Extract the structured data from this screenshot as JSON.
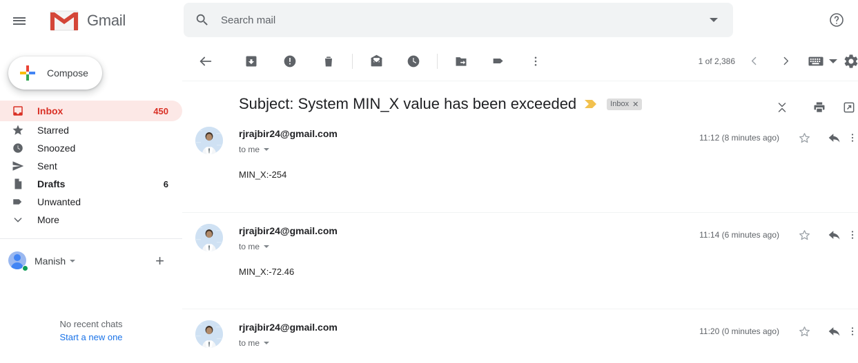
{
  "app": {
    "brand": "Gmail",
    "menu_icon": "hamburger-menu-icon",
    "logo_icon": "gmail-m-logo"
  },
  "search": {
    "placeholder": "Search mail",
    "value": "",
    "icon": "search-icon",
    "options_icon": "chevron-down-icon"
  },
  "header": {
    "help_icon": "help-question-icon"
  },
  "sidebar": {
    "compose": {
      "label": "Compose",
      "icon": "plus-icon"
    },
    "items": [
      {
        "label": "Inbox",
        "count": "450",
        "icon": "inbox-icon",
        "active": true
      },
      {
        "label": "Starred",
        "count": "",
        "icon": "star-icon",
        "active": false
      },
      {
        "label": "Snoozed",
        "count": "",
        "icon": "clock-icon",
        "active": false
      },
      {
        "label": "Sent",
        "count": "",
        "icon": "send-icon",
        "active": false
      },
      {
        "label": "Drafts",
        "count": "6",
        "icon": "draft-file-icon",
        "active": false
      },
      {
        "label": "Unwanted",
        "count": "",
        "icon": "label-tag-icon",
        "active": false
      },
      {
        "label": "More",
        "count": "",
        "icon": "chevron-down-icon",
        "active": false
      }
    ],
    "hangouts": {
      "user": "Manish",
      "user_caret_icon": "caret-down-icon",
      "avatar_icon": "user-avatar-icon",
      "status": "online",
      "new_chat_icon": "plus-icon",
      "empty_text": "No recent chats",
      "start_link": "Start a new one"
    }
  },
  "toolbar": {
    "buttons": [
      {
        "name": "back-to-inbox",
        "icon": "arrow-left-icon"
      },
      {
        "name": "archive",
        "icon": "archive-icon"
      },
      {
        "name": "report-spam",
        "icon": "report-spam-icon"
      },
      {
        "name": "delete",
        "icon": "trash-icon"
      },
      {
        "name": "mark-as-unread",
        "icon": "mail-open-icon"
      },
      {
        "name": "snooze",
        "icon": "clock-icon"
      },
      {
        "name": "move-to",
        "icon": "move-to-folder-icon"
      },
      {
        "name": "labels",
        "icon": "label-tag-icon"
      },
      {
        "name": "more-options",
        "icon": "more-vertical-icon"
      }
    ],
    "pagination": "1 of 2,386",
    "prev_icon": "chevron-left-icon",
    "next_icon": "chevron-right-icon",
    "keyboard_icon": "keyboard-icon",
    "keyboard_caret_icon": "caret-down-icon",
    "settings_icon": "gear-icon"
  },
  "thread": {
    "subject": "Subject: System MIN_X value has been exceeded",
    "important_icon": "important-chevron-icon",
    "label": "Inbox",
    "label_remove_icon": "close-x-icon",
    "actions": {
      "collapse_icon": "collapse-all-icon",
      "print_icon": "print-icon",
      "popout_icon": "open-in-new-window-icon"
    },
    "messages": [
      {
        "from": "rjrajbir24@gmail.com",
        "to": "to me",
        "to_caret_icon": "caret-down-icon",
        "date": "11:12 (8 minutes ago)",
        "body": "MIN_X:-254",
        "star_icon": "star-outline-icon",
        "reply_icon": "reply-icon",
        "more_icon": "more-vertical-icon",
        "avatar_icon": "contact-photo-avatar"
      },
      {
        "from": "rjrajbir24@gmail.com",
        "to": "to me",
        "to_caret_icon": "caret-down-icon",
        "date": "11:14 (6 minutes ago)",
        "body": "MIN_X:-72.46",
        "star_icon": "star-outline-icon",
        "reply_icon": "reply-icon",
        "more_icon": "more-vertical-icon",
        "avatar_icon": "contact-photo-avatar"
      },
      {
        "from": "rjrajbir24@gmail.com",
        "to": "to me",
        "to_caret_icon": "caret-down-icon",
        "date": "11:20 (0 minutes ago)",
        "body": "",
        "star_icon": "star-outline-icon",
        "reply_icon": "reply-icon",
        "more_icon": "more-vertical-icon",
        "avatar_icon": "contact-photo-avatar"
      }
    ]
  },
  "colors": {
    "accent_red": "#d93025",
    "inbox_highlight": "#fce8e6",
    "link_blue": "#1a73e8",
    "text_primary": "#202124",
    "text_secondary": "#5f6368",
    "important_yellow": "#f2c14e",
    "online_green": "#0f9d58"
  }
}
